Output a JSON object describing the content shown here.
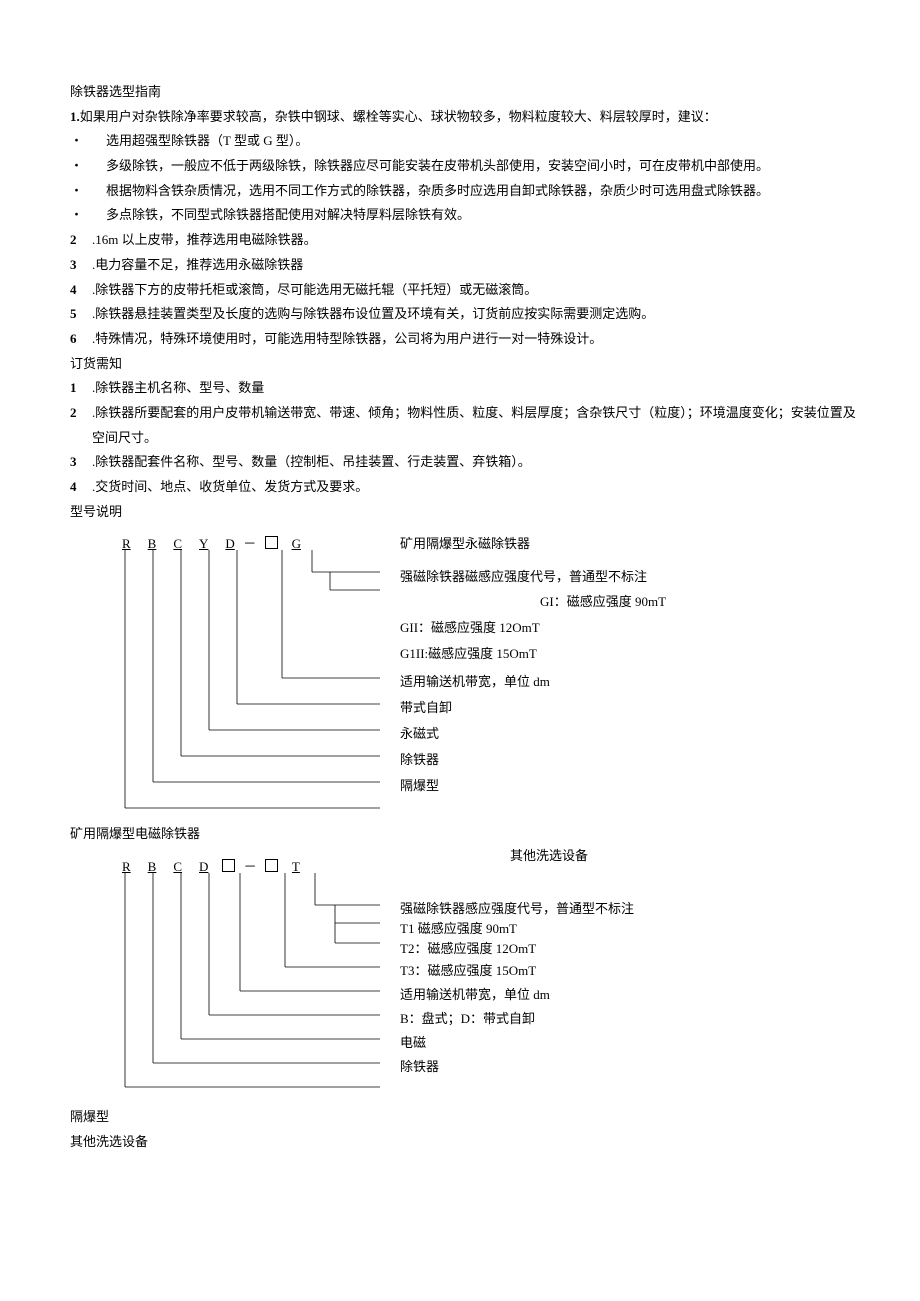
{
  "title": "除铁器选型指南",
  "intro_num": "1.",
  "intro": "如果用户对杂铁除净率要求较高，杂铁中钢球、螺栓等实心、球状物较多，物料粒度较大、料层较厚时，建议：",
  "bullets": [
    "选用超强型除铁器（T 型或 G 型）。",
    "多级除铁，一般应不低于两级除铁，除铁器应尽可能安装在皮带机头部使用，安装空间小时，可在皮带机中部使用。",
    "根据物料含铁杂质情况，选用不同工作方式的除铁器，杂质多时应选用自卸式除铁器，杂质少时可选用盘式除铁器。",
    "多点除铁，不同型式除铁器搭配使用对解决特厚料层除铁有效。"
  ],
  "num_points": [
    {
      "n": "2",
      "t": ".16m 以上皮带，推荐选用电磁除铁器。"
    },
    {
      "n": "3",
      "t": ".电力容量不足，推荐选用永磁除铁器"
    },
    {
      "n": "4",
      "t": ".除铁器下方的皮带托柜或滚筒，尽可能选用无磁托辊（平托短）或无磁滚筒。"
    },
    {
      "n": "5",
      "t": ".除铁器悬挂装置类型及长度的选购与除铁器布设位置及环境有关，订货前应按实际需要测定选购。"
    },
    {
      "n": "6",
      "t": ".特殊情况，特殊环境使用时，可能选用特型除铁器，公司将为用户进行一对一特殊设计。"
    }
  ],
  "order_title": "订货需知",
  "order_points": [
    {
      "n": "1",
      "t": ".除铁器主机名称、型号、数量"
    },
    {
      "n": "2",
      "t": ".除铁器所要配套的用户皮带机输送带宽、带速、倾角；物料性质、粒度、料层厚度；含杂铁尺寸（粒度）；环境温度变化；安装位置及空间尺寸。"
    },
    {
      "n": "3",
      "t": ".除铁器配套件名称、型号、数量（控制柜、吊挂装置、行走装置、弃铁箱）。"
    },
    {
      "n": "4",
      "t": ".交货时间、地点、收货单位、发货方式及要求。"
    }
  ],
  "model_title": "型号说明",
  "d1": {
    "title": "矿用隔爆型永磁除铁器",
    "code": {
      "c1": "R",
      "c2": "B",
      "c3": "C",
      "c4": "Y",
      "c5": "D",
      "dash": "－",
      "c6": "G"
    },
    "l1": "强磁除铁器磁感应强度代号，普通型不标注",
    "l1b": "GI：磁感应强度 90mT",
    "l2": "GII：磁感应强度 12OmT",
    "l3": "G1II:磁感应强度 15OmT",
    "l4": "适用输送机带宽，单位 dm",
    "l5": "带式自卸",
    "l6": "永磁式",
    "l7": "除铁器",
    "l8": "隔爆型"
  },
  "d2": {
    "pre_title": "矿用隔爆型电磁除铁器",
    "right_title": "其他洗选设备",
    "code": {
      "c1": "R",
      "c2": "B",
      "c3": "C",
      "c4": "D",
      "dash": "－",
      "c5": "T"
    },
    "l1": "强磁除铁器感应强度代号，普通型不标注",
    "l2": "T1 磁感应强度 90mT",
    "l3": "T2：磁感应强度 12OmT",
    "l4": "T3：磁感应强度 15OmT",
    "l5": "适用输送机带宽，单位 dm",
    "l6": "B：盘式；D：带式自卸",
    "l7": "电磁",
    "l8": "除铁器"
  },
  "footer1": "隔爆型",
  "footer2": "其他洗选设备"
}
